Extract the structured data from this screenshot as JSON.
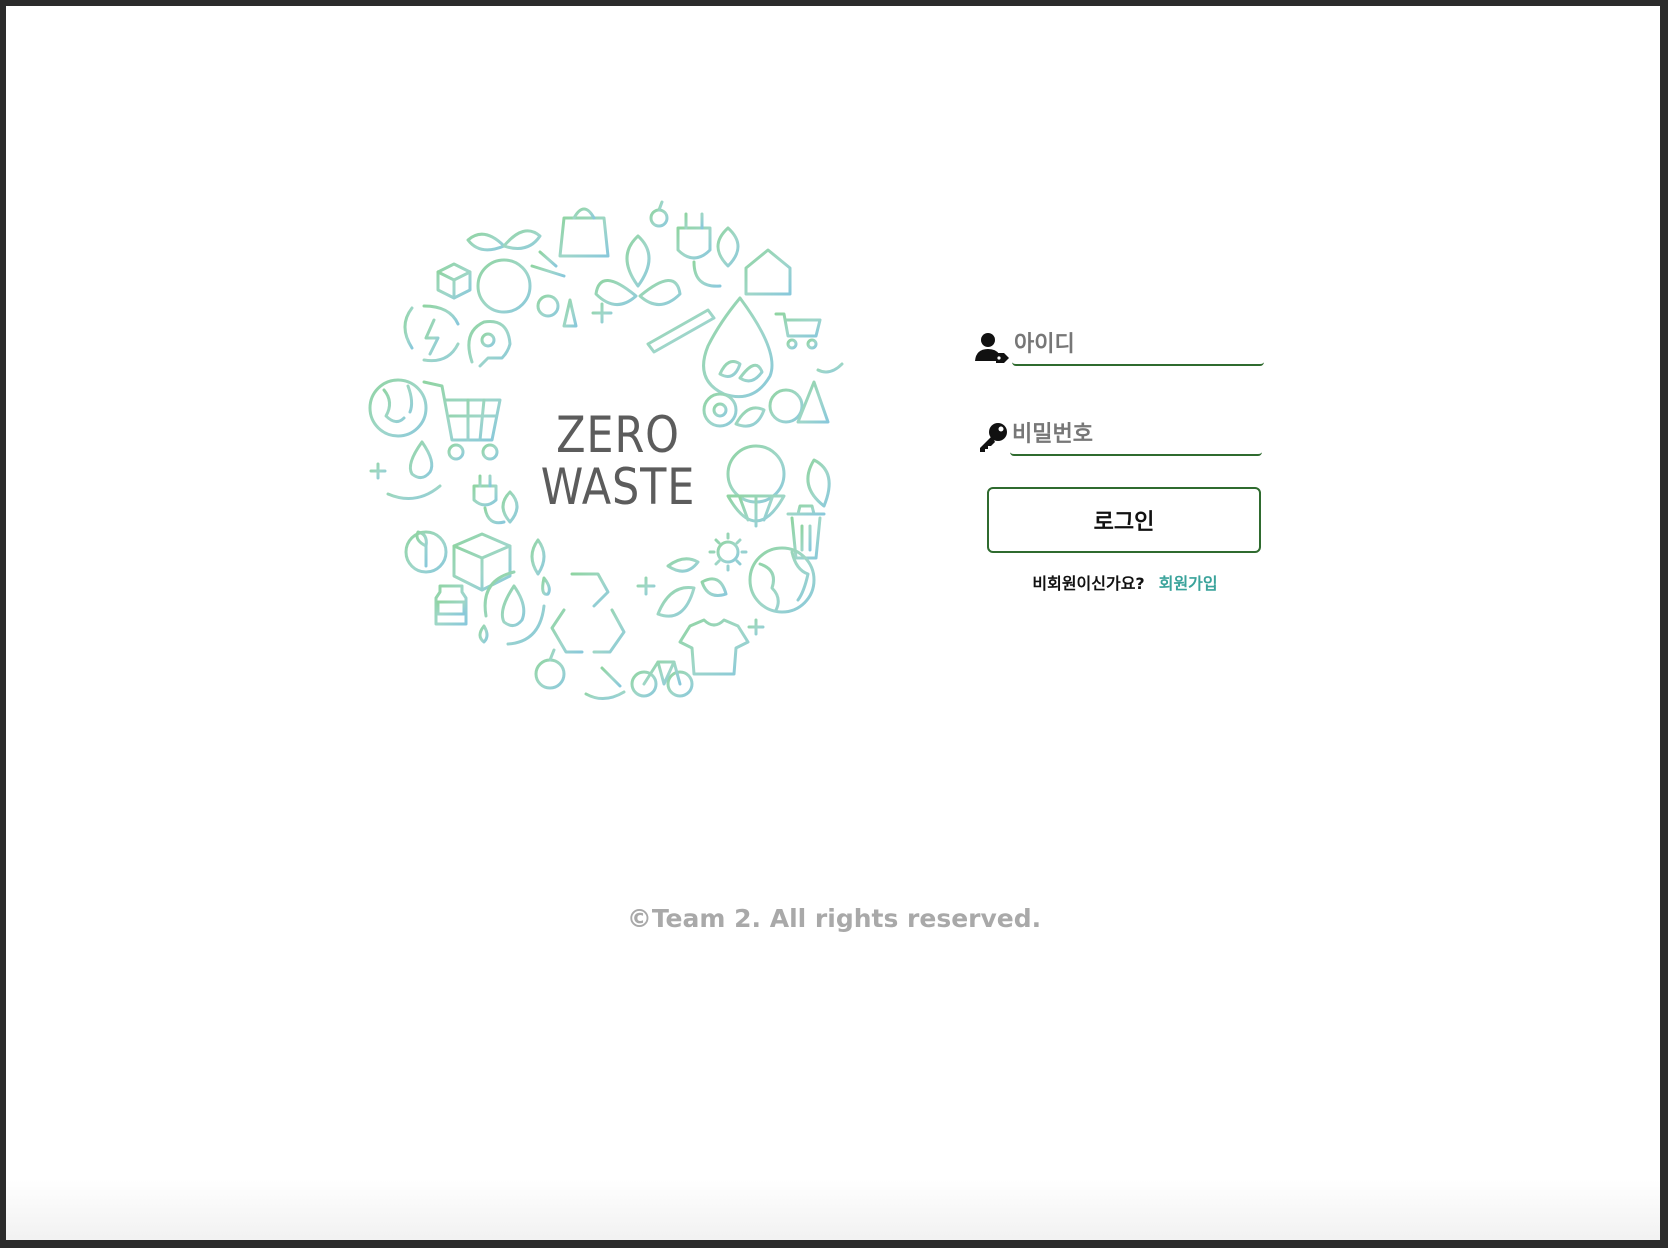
{
  "logo": {
    "line1": "ZERO",
    "line2": "WASTE",
    "gradient_colors": [
      "#8fd4a2",
      "#9fd6c9",
      "#88c8db"
    ],
    "icon_names": [
      "shopping-bag-icon",
      "plant-icon",
      "plug-icon",
      "globe-icon",
      "cart-icon",
      "recycle-icon",
      "water-drop-icon",
      "tree-icon",
      "lemon-icon",
      "trash-can-icon",
      "t-shirt-icon",
      "bicycle-icon",
      "leaf-icon",
      "box-icon",
      "jar-icon",
      "gear-icon",
      "lightbulb-icon",
      "house-icon",
      "toothbrush-icon",
      "apple-icon",
      "sun-icon",
      "hand-icon",
      "sparkle-icon"
    ]
  },
  "login": {
    "id_placeholder": "아이디",
    "id_icon": "user-tag-icon",
    "password_placeholder": "비밀번호",
    "password_icon": "key-icon",
    "login_label": "로그인",
    "signup_question": "비회원이신가요?",
    "signup_link": "회원가입",
    "accent_color": "#2f6b2f",
    "link_color": "#3aa39b"
  },
  "footer": {
    "copyright": "©Team 2. All rights reserved."
  }
}
